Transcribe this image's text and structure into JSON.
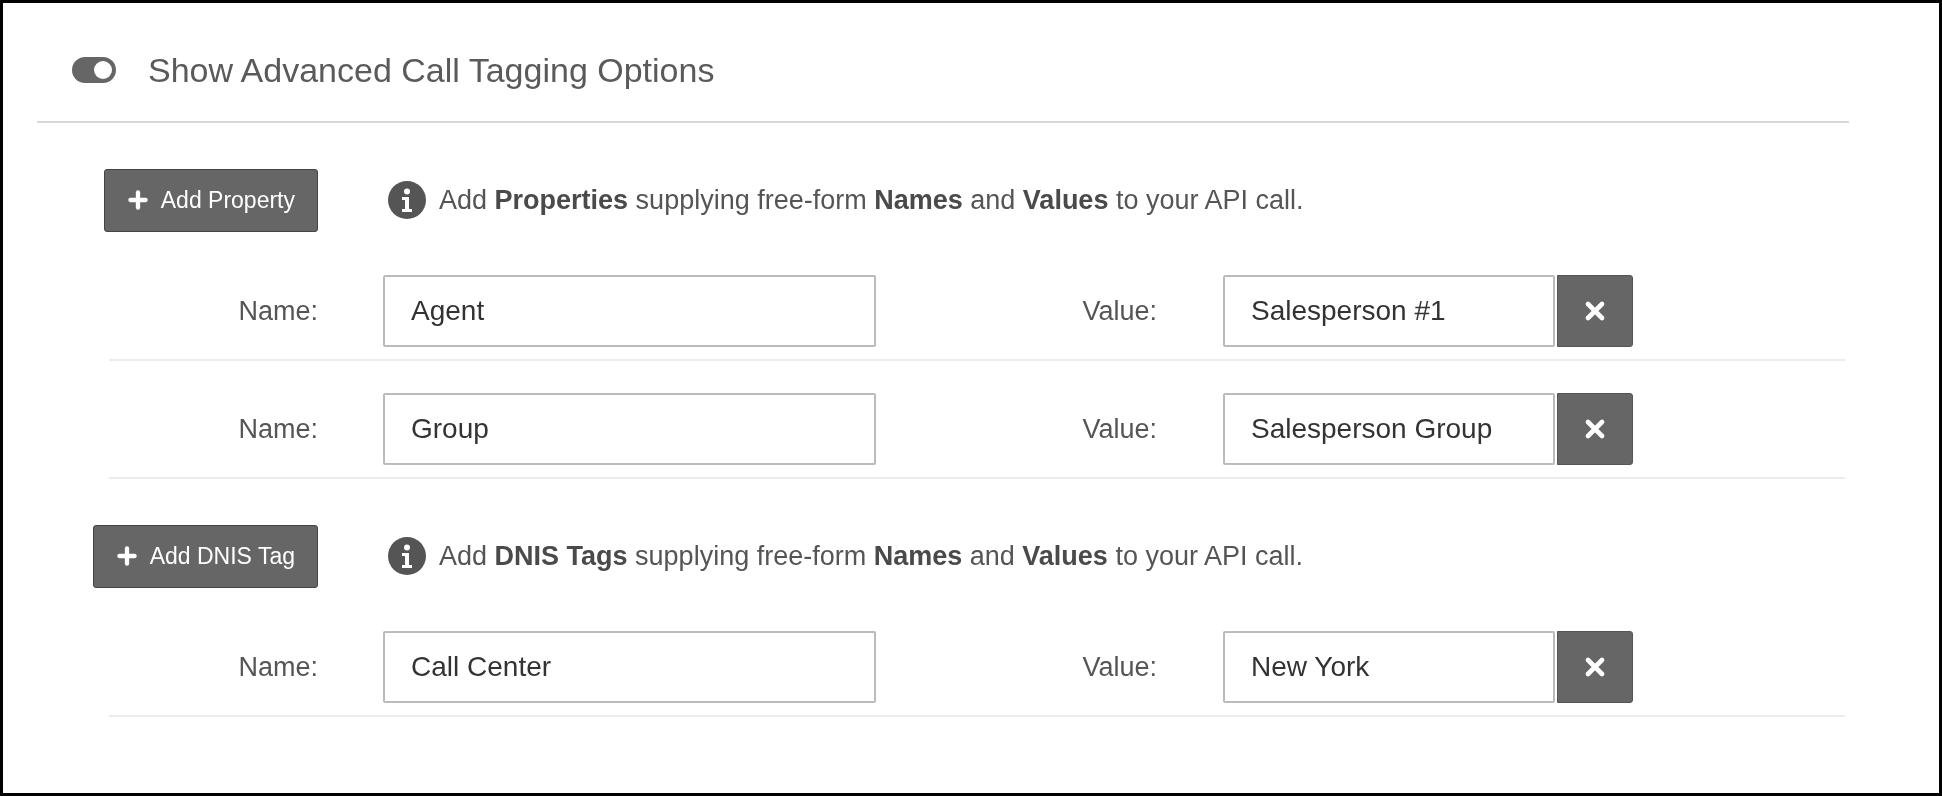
{
  "toggle": {
    "label": "Show Advanced Call Tagging Options",
    "on": true
  },
  "sections": [
    {
      "button": "Add Property",
      "help": "Add **Properties** supplying free-form **Names** and **Values** to your API call.",
      "rows": [
        {
          "name_label": "Name:",
          "name": "Agent",
          "value_label": "Value:",
          "value": "Salesperson #1"
        },
        {
          "name_label": "Name:",
          "name": "Group",
          "value_label": "Value:",
          "value": "Salesperson Group"
        }
      ]
    },
    {
      "button": "Add DNIS Tag",
      "help": "Add **DNIS Tags** supplying free-form **Names** and **Values** to your API call.",
      "rows": [
        {
          "name_label": "Name:",
          "name": "Call Center",
          "value_label": "Value:",
          "value": "New York"
        }
      ]
    }
  ]
}
